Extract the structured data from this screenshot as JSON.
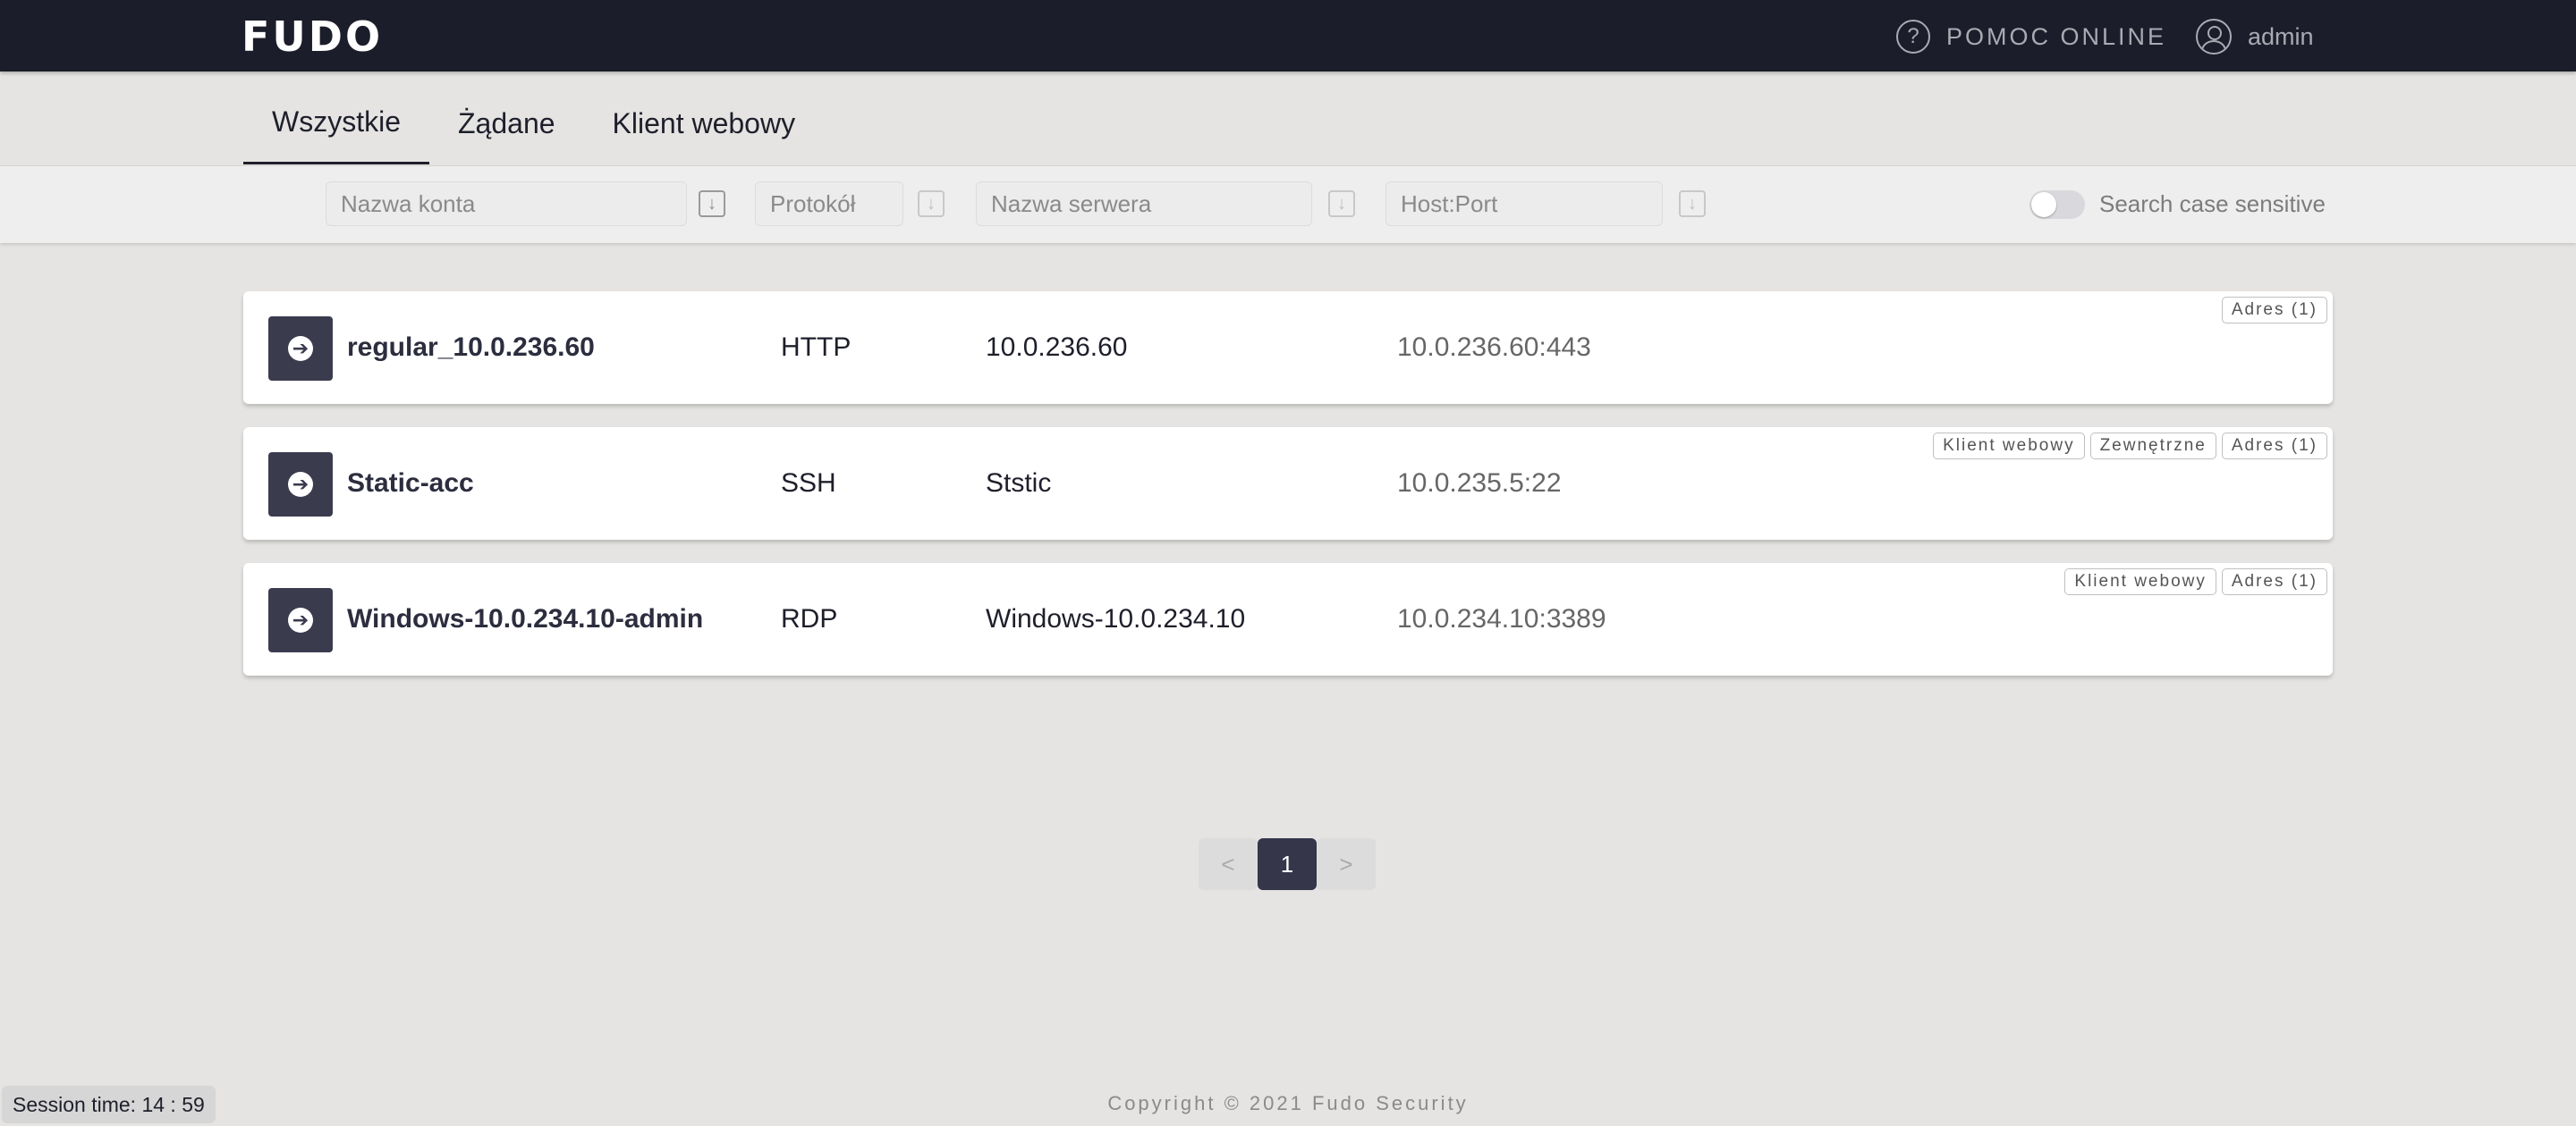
{
  "header": {
    "logo": "FUDO",
    "help_icon": "question-circle-icon",
    "help_label": "POMOC ONLINE",
    "user_icon": "user-circle-icon",
    "user_name": "admin"
  },
  "tabs": [
    {
      "label": "Wszystkie",
      "active": true
    },
    {
      "label": "Żądane",
      "active": false
    },
    {
      "label": "Klient webowy",
      "active": false
    }
  ],
  "filters": {
    "account_placeholder": "Nazwa konta",
    "protocol_placeholder": "Protokół",
    "server_placeholder": "Nazwa serwera",
    "host_placeholder": "Host:Port",
    "sort_icon": "sort-down-icon",
    "case_sensitive_label": "Search case sensitive",
    "case_sensitive_on": false
  },
  "rows": [
    {
      "name": "regular_10.0.236.60",
      "protocol": "HTTP",
      "server": "10.0.236.60",
      "host": "10.0.236.60:443",
      "badges": [
        "Adres (1)"
      ]
    },
    {
      "name": "Static-acc",
      "protocol": "SSH",
      "server": "Ststic",
      "host": "10.0.235.5:22",
      "badges": [
        "Klient webowy",
        "Zewnętrzne",
        "Adres (1)"
      ]
    },
    {
      "name": "Windows-10.0.234.10-admin",
      "protocol": "RDP",
      "server": "Windows-10.0.234.10",
      "host": "10.0.234.10:3389",
      "badges": [
        "Klient webowy",
        "Adres (1)"
      ]
    }
  ],
  "pagination": {
    "prev": "<",
    "current": "1",
    "next": ">"
  },
  "session_time": "Session time: 14 : 59",
  "copyright": "Copyright © 2021 Fudo Security",
  "colors": {
    "topbar": "#1c1d2a",
    "accent": "#35364a",
    "background": "#e5e4e2"
  }
}
